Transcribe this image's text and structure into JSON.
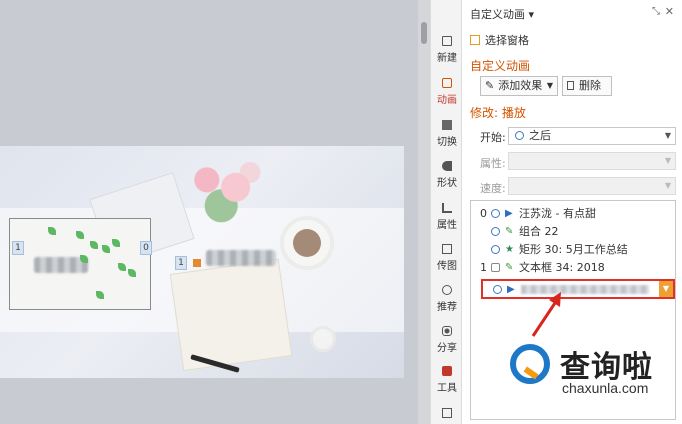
{
  "sidebar": {
    "items": [
      {
        "label": "新建",
        "icon": "new-doc-icon"
      },
      {
        "label": "动画",
        "icon": "animation-icon"
      },
      {
        "label": "切换",
        "icon": "transition-icon"
      },
      {
        "label": "形状",
        "icon": "shape-icon"
      },
      {
        "label": "属性",
        "icon": "properties-icon"
      },
      {
        "label": "传图",
        "icon": "upload-image-icon"
      },
      {
        "label": "推荐",
        "icon": "recommend-icon"
      },
      {
        "label": "分享",
        "icon": "share-icon"
      },
      {
        "label": "工具",
        "icon": "toolbox-icon"
      }
    ]
  },
  "panel": {
    "title": "自定义动画",
    "title_caret": "▾",
    "select_pane": "选择窗格",
    "section_title": "自定义动画",
    "add_effect": "添加效果",
    "delete": "删除",
    "modify_label": "修改: 播放",
    "start_label": "开始:",
    "start_value": "之后",
    "property_label": "属性:",
    "speed_label": "速度:"
  },
  "animation_list": [
    {
      "num": "0",
      "effect": "play",
      "text": "汪苏泷 - 有点甜"
    },
    {
      "num": "",
      "effect": "pin",
      "text": "组合 22"
    },
    {
      "num": "",
      "effect": "star",
      "text": "矩形 30: 5月工作总结"
    },
    {
      "num": "1",
      "effect": "fly",
      "text": "文本框 34: 2018"
    }
  ],
  "slide": {
    "tags": [
      "1",
      "0",
      "1"
    ]
  },
  "watermark": {
    "cn": "查询啦",
    "url": "chaxunla.com"
  },
  "colors": {
    "accent_orange": "#d35400",
    "highlight_red": "#e0302a",
    "brand_blue": "#1e78c8"
  }
}
